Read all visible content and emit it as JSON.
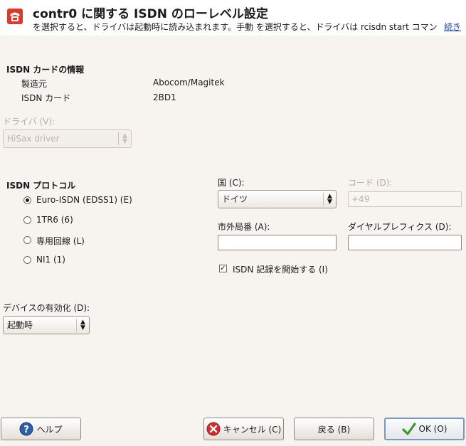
{
  "header": {
    "title": "contr0 に関する ISDN のローレベル設定",
    "description": "を選択すると、ドライバは起動時に読み込まれます。手動 を選択すると、ドライバは rcisdn start コマンド...",
    "more_link": "続き"
  },
  "card_info": {
    "heading": "ISDN カードの情報",
    "manufacturer_label": "製造元",
    "manufacturer_value": "Abocom/Magitek",
    "card_label": "ISDN カード",
    "card_value": "2BD1"
  },
  "driver": {
    "label": "ドライバ (V):",
    "value": "HiSax driver"
  },
  "protocol": {
    "heading": "ISDN プロトコル",
    "options": [
      {
        "label": "Euro-ISDN (EDSS1) (E)",
        "checked": true
      },
      {
        "label": "1TR6 (6)",
        "checked": false
      },
      {
        "label": "専用回線 (L)",
        "checked": false
      },
      {
        "label": "NI1 (1)",
        "checked": false
      }
    ]
  },
  "country": {
    "label": "国 (C):",
    "value": "ドイツ"
  },
  "code": {
    "label": "コード (D):",
    "value": "+49"
  },
  "area_code": {
    "label": "市外局番 (A):",
    "value": ""
  },
  "dial_prefix": {
    "label": "ダイヤルプレフィクス (D):",
    "value": ""
  },
  "logging": {
    "label": "ISDN 記録を開始する (I)",
    "checked": true
  },
  "device_activation": {
    "label": "デバイスの有効化 (D):",
    "value": "起動時"
  },
  "buttons": {
    "help": "ヘルプ",
    "cancel": "キャンセル (C)",
    "back": "戻る (B)",
    "ok": "OK (O)"
  }
}
